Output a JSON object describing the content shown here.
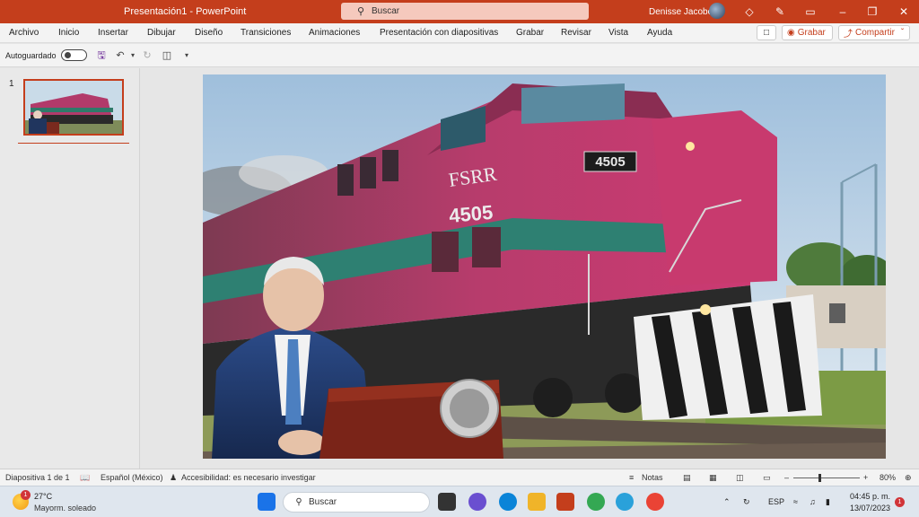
{
  "window": {
    "title": "Presentación1  -  PowerPoint",
    "search_placeholder": "Buscar",
    "user_name": "Denisse Jacobo"
  },
  "ribbon": {
    "tabs": [
      "Archivo",
      "Inicio",
      "Insertar",
      "Dibujar",
      "Diseño",
      "Transiciones",
      "Animaciones",
      "Presentación con diapositivas",
      "Grabar",
      "Revisar",
      "Vista",
      "Ayuda"
    ],
    "record_label": "Grabar",
    "share_label": "Compartir"
  },
  "qat": {
    "autosave_label": "Autoguardado",
    "autosave_state": "off"
  },
  "thumbnails": {
    "slide_number": "1"
  },
  "slide": {
    "locomotive_text": "FSRR",
    "locomotive_number": "4505",
    "number_plate": "4505"
  },
  "statusbar": {
    "slide_info": "Diapositiva 1 de 1",
    "language": "Español (México)",
    "accessibility": "Accesibilidad: es necesario investigar",
    "notes_label": "Notas",
    "zoom": "80%"
  },
  "taskbar": {
    "weather_temp": "27°C",
    "weather_condition": "Mayorm. soleado",
    "weather_badge": "1",
    "search_label": "Buscar",
    "language": "ESP",
    "time": "04:45 p. m.",
    "date": "13/07/2023",
    "notification_count": "1"
  },
  "colors": {
    "accent": "#c43e1c",
    "titlebar": "#c43e1c",
    "ribbon_bg": "#f3f3f3",
    "taskbar_bg": "#dfe6ee"
  }
}
